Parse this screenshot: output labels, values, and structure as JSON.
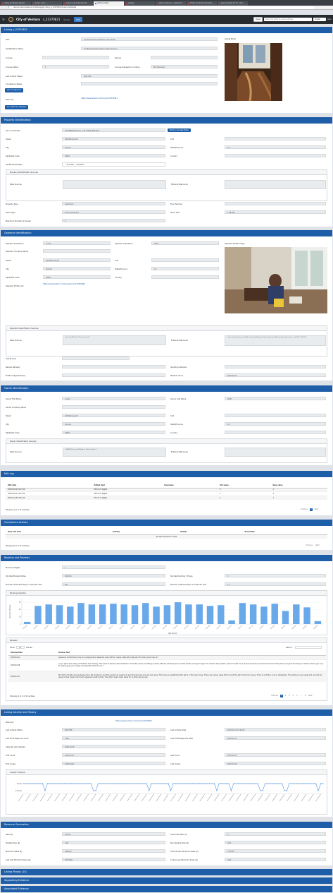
{
  "browser": {
    "tabs": [
      "Listing by Wheelie Capital...",
      "Gmail - Inbox - ...",
      "Granicus Short-Term Rental",
      "Ventura Listing",
      "Listings",
      "Host Compliance - Dashboard",
      "Profile: Short-Term Rental Pe...",
      "Search Results for 'TC' - Hos..."
    ],
    "url": "ventura.hostcompliance.com/listings/get_listing_id_23370821?locale=en#/details"
  },
  "appbar": {
    "city": "City of Ventura",
    "listing_id": "s_23370821",
    "goto": "Go to...",
    "edit": "Edit",
    "reset": "Reset",
    "search_placeholder": "Search by listing ID, name, address",
    "language": "English",
    "user": "Allen"
  },
  "listing": {
    "header": "Listing s_23370821",
    "title_label": "Title",
    "title": "Use Swale family Bedroom cozy dental",
    "id_status_label": "Identification Status",
    "id_status": "Ct (Multi Operators/Owner Owner Known)",
    "license_label": "License",
    "license": "",
    "parcel_label": "Parcels",
    "parcel": "",
    "license_status_label": "License Status",
    "license_status": "1",
    "license_displayed_label": "License Displayed on Listing",
    "license_displayed": "Not Displayed",
    "last_activity_label": "Last Activity Status",
    "last_activity": "INACTIVE",
    "compliance_label": "Compliance Status",
    "compliance": "",
    "add_compliance": "Add compliance",
    "web_link_label": "Web Link",
    "web_link": "https://www.airbnb.com/rooms/23370821",
    "go_checker": "Go reach the Checker",
    "photo_label": "Listing Photo"
  },
  "property": {
    "header": "Property Identification",
    "geo_label": "Geo-coordinates",
    "geo": "34.2898654101514, -119.2783246587243",
    "map_btn": "Show in Google Maps",
    "street_label": "Street",
    "street": "440 Mariposa Dr",
    "unit_label": "Unit",
    "unit": "",
    "city_label": "City",
    "city": "Ventura",
    "state_label": "State/Province",
    "state": "CA",
    "zip_label": "Zip/Postal Code",
    "zip": "93001",
    "country_label": "Country",
    "country": "",
    "verified_label": "Verified Duplicates",
    "verified": "✓ 6011896  ✓ 54048851",
    "sources_hdr": "Property Identification Sources",
    "data_sources_label": "Data Sources",
    "external_label": "External Web Links",
    "ptype_label": "Property Type",
    "ptype": "Apartment",
    "floor_label": "Floor Number",
    "floor": "",
    "rtype_label": "Room Type",
    "rtype": "Entire apartment",
    "rsize_label": "Room Size",
    "rsize": "1 BR 1BA",
    "guests_label": "Maximum Number of Guests",
    "guests": "2"
  },
  "operator": {
    "header": "Operator Identification",
    "first_label": "Operator First Name",
    "first": "Lucille",
    "last_label": "Operator Last Name",
    "last": "Duffy",
    "company_label": "Operator Company Name",
    "company": "",
    "image_label": "Operator Profile Image",
    "street_label": "Street",
    "street": "440 Mariposa Dr",
    "unit_label": "Unit",
    "unit": "",
    "city_label": "City",
    "city": "Ventura",
    "state_label": "State/Province",
    "state": "CA",
    "zip_label": "Zip/Postal Code",
    "zip": "93001",
    "country_label": "Country",
    "country": "",
    "profile_link_label": "Operator Profile Link",
    "profile_link": "https://www.airbnb.com/users/show/172849560",
    "sources_hdr": "Operator Identification Sources",
    "data_sources_label": "Data Sources",
    "data_sources": "External Website 1   Parcel Search 1",
    "external_label": "External Web Links",
    "external": "https://www.airnb.com/info/Neru-Housing/Paragon-House-descritor-440-mariposa-dr-ventura-ca-93001_7521235",
    "host_label": "Listing Host",
    "reviews_label": "Review Name(s)",
    "signatory_label": "Signatory Name(s)",
    "profile_img_label": "Profile Image Name(s)",
    "member_label": "Member Since",
    "member": "2018-02-01"
  },
  "owner": {
    "header": "Owner Identification",
    "first_label": "Owner First Name",
    "first": "Lucille",
    "last_label": "Owner Last Name",
    "last": "Duffy",
    "company_label": "Owner Company Name",
    "company": "",
    "street_label": "Street",
    "street": "440 Mariposa Dr",
    "unit_label": "Unit",
    "unit": "",
    "city_label": "City",
    "city": "Ventura",
    "state_label": "State/Province",
    "state": "CA",
    "zip_label": "Zip/Postal Code",
    "zip": "93001",
    "country_label": "Country",
    "country": "",
    "sources_hdr": "Owner Identification Sources",
    "data_sources_label": "Data Sources",
    "data_sources": "6085801   External Website 1   Parcel Search 1",
    "external_label": "External Web Links"
  },
  "editlog": {
    "header": "Edit Log",
    "columns": [
      "Edit date",
      "Edited field",
      "Username",
      "Old value",
      "New value"
    ],
    "rows": [
      [
        "2018-08-20 16:27:00",
        "Minimum Nights",
        "",
        "3",
        "1"
      ],
      [
        "2018-09-01 16:21:00",
        "Minimum Nights",
        "",
        "1",
        "2"
      ],
      [
        "2018-10-28 16:01:00",
        "Minimum Nights",
        "",
        "2",
        "1"
      ]
    ],
    "info": "Showing 1 to 3 of 3 entries",
    "prev": "Previous",
    "page": "1",
    "next": "Next"
  },
  "compliance": {
    "header": "Compliance Activity",
    "columns": [
      "Date and time",
      "Activity",
      "Details",
      "Resolution"
    ],
    "empty": "No data available in table",
    "info": "Showing 0 to 0 of 0 entries",
    "prev": "Previous",
    "next": "Next"
  },
  "booking": {
    "header": "Booking and Reviews",
    "min_nights_label": "Minimum Nights",
    "min_nights": "1",
    "shortest_date_label": "Shortest Booked Dates",
    "shortest_date": "2018-06",
    "shortest_days_label": "Shortest Number of Days",
    "shortest_days": "3",
    "booked_label": "Number of Booked Days in Calendar Year",
    "booked": "603",
    "reviews_label": "Number of Review Days in Calendar Year",
    "reviews": "11",
    "calendar_hdr": "Booking Calendar",
    "reviews_hdr": "Reviews",
    "show_label": "Show",
    "show_value": "10",
    "entries_label": "entries",
    "search_label": "Search:",
    "review_cols": [
      "Review Date",
      "Review Text"
    ],
    "review_rows": [
      [
        "2018-04-01",
        "Awesome architectural cozy and unique place. Awesome view. Kitchen needs a few extra utensils. But clean place over all."
      ],
      [
        "2018-04-08",
        "Lucy's place was really comfortable and relaxing. The views of Ventura were fantastic! I loved the quote and sitting up there with the windows open and the breeze coming through. The location was perfect, quiet and safe. For a unique experience I would recommend this place to anyone who stays in Ventura. Thank you Lucy for opening up your unique and beautiful home to us! :)"
      ],
      [
        "2018-04-17",
        "We didn't actually end up staying here. We checked in and then ended up needing to go home because of a pet care issue. The house is beautiful but the apt is in the main house. There are various areas that connect the apt to the main house. There is a kitchen, but no refrigerator. The hosts are very sweet and nice but my guess is they haven't had much experience with Airbnb. They didn't seem quite ready for us when we arrived."
      ]
    ],
    "reviews_info": "Showing 1 to 3 of 24 entries",
    "prev": "Previous",
    "pages": [
      "1",
      "2",
      "3",
      "4",
      "5",
      "...",
      "8"
    ],
    "next": "Next"
  },
  "activity": {
    "header": "Listing Activity and History",
    "web_link_label": "Web Link",
    "web_link": "https://www.airbnb.com/rooms/23370821",
    "last_status_label": "Last Activity Status",
    "last_status": "INACTIVE",
    "last_date_label": "Last Activity Date",
    "last_date": "2018-11-01 10:03:00",
    "http_code_label": "Last HTTP Response Code",
    "http_code": "1300",
    "http_date_label": "Last HTTP Response Date",
    "http_date": "2018-11-01",
    "cal_updated_label": "Calendar last updated",
    "cal_updated": "2018-10-30",
    "first_found_label": "First found",
    "first_found": "2018-03-27",
    "last_found_label": "Last found",
    "last_found": "2018-10-23",
    "first_review_label": "First review",
    "first_review": "2018-04-01",
    "last_review_label": "Last review",
    "last_review": "2018-10-30",
    "timeline_hdr": "Activity Timeline",
    "timeline_active": "Active",
    "timeline_inactive": "Inactive"
  },
  "revenue": {
    "header": "Revenue Generation",
    "rate_label": "Rate ($)",
    "rate": "125.00",
    "tax_label": "Listed Tax Rate (%)",
    "tax": "0",
    "taxable_label": "Taxable Fees ($)",
    "taxable": "0.00",
    "nontax_label": "Non-taxable Fees ($)",
    "nontax": "0.00",
    "min_sales_label": "Minimum Sales ($)",
    "min_sales": "3680.00",
    "cy_min_label": "Current Year Minimum Sales ($)",
    "cy_min": "2700.00",
    "ly_min_label": "Last Year Minimum Sales ($)",
    "ly_min": "22770.00",
    "two_y_label": "2 Years Ago Minimum Sales ($)",
    "two_y": "0.00"
  },
  "collapsed": {
    "photos": "Listing Photos (14)",
    "supporting": "Supporting Evidence",
    "associated": "Associated Evidence"
  },
  "chart_data": [
    {
      "type": "bar",
      "title": "Booking Calendar",
      "xlabel": "Year-Month",
      "ylabel": "Number of Days",
      "categories": [
        "2018-03",
        "2018-04",
        "2018-05",
        "2018-06",
        "2018-07",
        "2018-08",
        "2018-09",
        "2018-10",
        "2018-11",
        "2018-12",
        "2019-01",
        "2019-02",
        "2019-03",
        "2019-04",
        "2019-05",
        "2019-06",
        "2019-07",
        "2019-08",
        "2019-09",
        "2019-10",
        "2019-11",
        "2019-12",
        "2020-01",
        "2020-02",
        "2020-03",
        "2020-04",
        "2020-05",
        "2020-06"
      ],
      "values": [
        3,
        25,
        27,
        26,
        24,
        29,
        27,
        27,
        28,
        27,
        26,
        29,
        24,
        26,
        30,
        27,
        27,
        25,
        26,
        5,
        29,
        27,
        24,
        28,
        18,
        27,
        23,
        4
      ],
      "ylim": [
        0,
        35
      ],
      "color": "#6aa9e9"
    },
    {
      "type": "line",
      "title": "Activity Timeline",
      "ylabel": "",
      "series_levels": [
        "Active",
        "Inactive"
      ],
      "values": [
        1,
        1,
        1,
        1,
        1,
        1,
        1,
        1,
        1,
        0,
        1,
        1,
        1,
        1,
        1,
        1,
        1,
        1,
        1,
        1,
        1,
        1,
        1,
        1,
        1,
        1,
        1,
        1,
        1,
        0,
        0,
        1,
        1,
        1,
        1,
        1,
        1,
        1,
        1,
        1,
        1,
        1,
        1,
        1,
        1,
        1,
        1,
        1,
        1,
        1,
        1,
        1,
        0,
        1,
        1,
        1,
        1,
        1,
        1,
        1,
        1,
        0,
        1,
        1,
        1,
        1,
        1,
        1,
        1,
        1,
        1,
        1,
        1,
        1,
        1,
        1,
        1,
        1,
        1,
        1,
        0,
        1,
        1,
        1,
        1,
        1,
        0,
        1,
        1,
        1,
        1,
        1,
        1,
        1,
        1,
        1,
        1,
        1,
        0,
        0,
        1,
        1,
        1,
        1,
        1,
        1,
        1,
        1,
        0,
        0,
        1,
        1,
        1,
        1,
        1,
        1,
        1,
        1,
        1,
        1,
        1,
        1,
        0,
        1,
        1
      ],
      "color": "#2a7ad6"
    }
  ],
  "colors": {
    "header": "#1e5ea9",
    "appbar": "#272b30",
    "bars": "#6aa9e9"
  }
}
